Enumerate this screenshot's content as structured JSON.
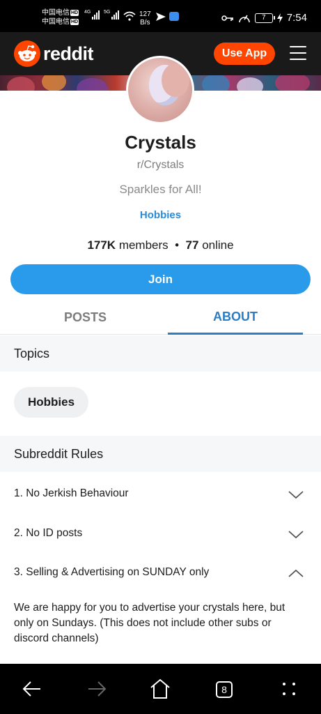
{
  "status_bar": {
    "carrier_1": "中国电信",
    "carrier_2": "中国电信",
    "hd_badge": "HD",
    "signal_1_label": "4G",
    "signal_2_label": "5G",
    "net_speed_value": "127",
    "net_speed_unit": "B/s",
    "battery": "7",
    "time": "7:54"
  },
  "header": {
    "brand": "reddit",
    "use_app_label": "Use App"
  },
  "community": {
    "title": "Crystals",
    "subreddit": "r/Crystals",
    "tagline": "Sparkles for All!",
    "category": "Hobbies",
    "members_count": "177K",
    "members_label": "members",
    "separator": "•",
    "online_count": "77",
    "online_label": "online",
    "join_label": "Join"
  },
  "tabs": [
    {
      "label": "POSTS",
      "active": false
    },
    {
      "label": "ABOUT",
      "active": true
    }
  ],
  "topics": {
    "heading": "Topics",
    "chips": [
      "Hobbies"
    ]
  },
  "rules": {
    "heading": "Subreddit Rules",
    "items": [
      {
        "label": "1. No Jerkish Behaviour",
        "expanded": false
      },
      {
        "label": "2. No ID posts",
        "expanded": false
      },
      {
        "label": "3. Selling & Advertising on SUNDAY only",
        "expanded": true,
        "description": "We are happy for you to advertise your crystals here, but only on Sundays. (This does not include other subs or discord channels)"
      }
    ]
  },
  "browser_nav": {
    "tab_count": "8"
  },
  "colors": {
    "reddit_orange": "#ff4500",
    "join_blue": "#2a9bea",
    "active_tab_blue": "#2a7dc6",
    "header_dark": "#1a1a1b"
  },
  "icons": [
    "reddit-logo-icon",
    "hamburger-menu-icon",
    "chevron-down-icon",
    "chevron-up-icon",
    "back-arrow-icon",
    "forward-arrow-icon",
    "home-icon",
    "more-options-icon",
    "wifi-icon",
    "key-icon",
    "speed-icon",
    "charging-icon"
  ]
}
